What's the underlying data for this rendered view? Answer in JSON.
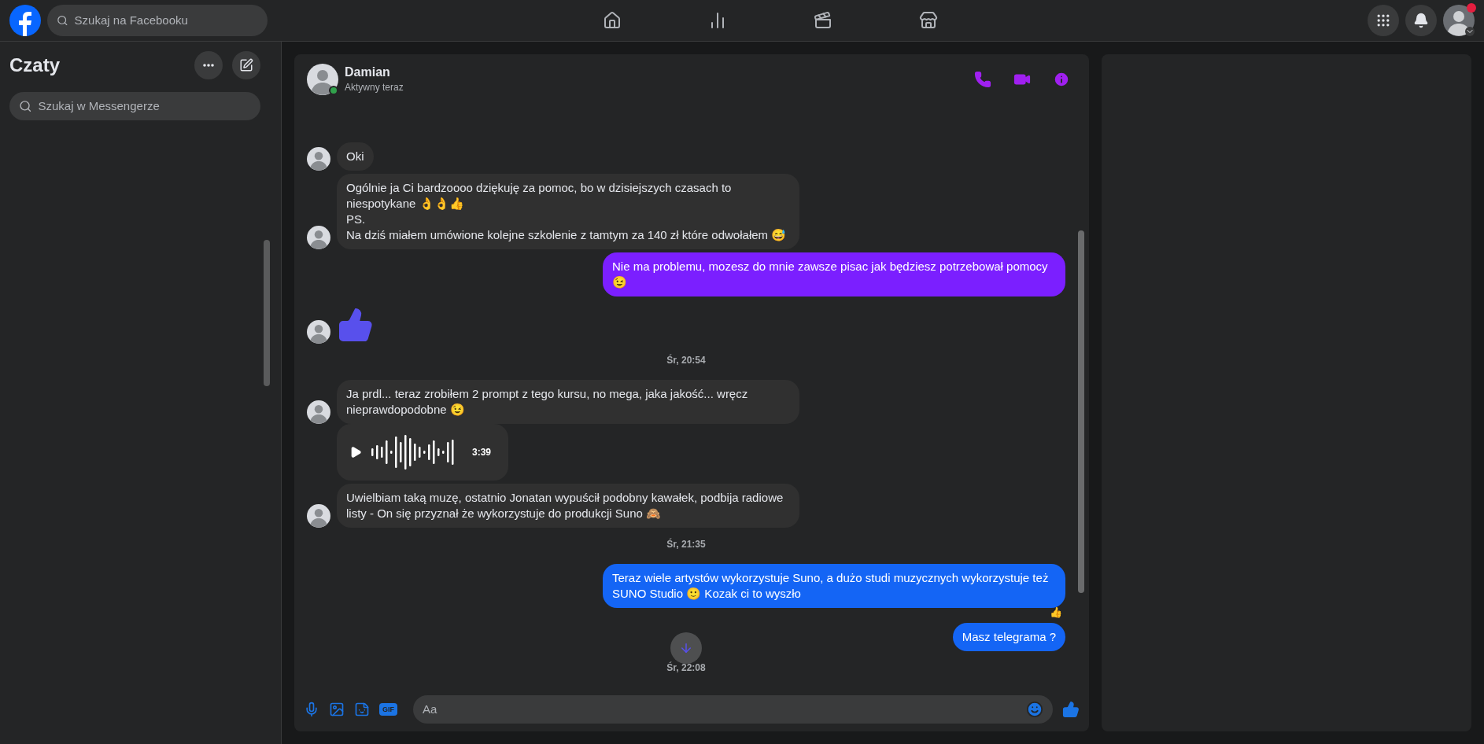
{
  "topbar": {
    "search_placeholder": "Szukaj na Facebooku",
    "notification_dot": true
  },
  "sidebar": {
    "title": "Czaty",
    "search_placeholder": "Szukaj w Messengerze"
  },
  "chat": {
    "name": "Damian",
    "status": "Aktywny teraz",
    "online": true,
    "messages": [
      {
        "kind": "text",
        "outgoing": false,
        "avatar": true,
        "text": "Oki"
      },
      {
        "kind": "text",
        "outgoing": false,
        "avatar": true,
        "text": "Ogólnie ja Ci bardzoooo dziękuję za pomoc, bo w dzisiejszych czasach to niespotykane 👌👌👍\nPS.\nNa dziś miałem umówione kolejne szkolenie z tamtym za 140 zł które odwołałem 😅"
      },
      {
        "kind": "text",
        "outgoing": true,
        "color": "#7b1fff",
        "text": "Nie ma problemu, mozesz do mnie zawsze pisac jak będziesz potrzebował pomocy 😉"
      },
      {
        "kind": "like",
        "avatar": true
      },
      {
        "kind": "time",
        "text": "Śr, 20:54"
      },
      {
        "kind": "text",
        "outgoing": false,
        "avatar": true,
        "text": "Ja prdl... teraz zrobiłem 2 prompt z tego kursu, no mega, jaka jakość... wręcz nieprawdopodobne 😉"
      },
      {
        "kind": "audio",
        "avatar": false,
        "duration": "3:39"
      },
      {
        "kind": "text",
        "outgoing": false,
        "avatar": true,
        "text": "Uwielbiam taką muzę, ostatnio Jonatan wypuścił podobny kawałek, podbija radiowe listy - On się przyznał że wykorzystuje do produkcji Suno 🙈"
      },
      {
        "kind": "time",
        "text": "Śr, 21:35"
      },
      {
        "kind": "text",
        "outgoing": true,
        "color": "#1465f5",
        "reaction": "👍",
        "text": "Teraz wiele artystów wykorzystuje Suno, a dużo studi muzycznych wykorzystuje też SUNO Studio 🙂 Kozak ci to wyszło"
      },
      {
        "kind": "text",
        "outgoing": true,
        "color": "#1465f5",
        "text": "Masz telegrama ?"
      },
      {
        "kind": "time",
        "text": "Śr, 22:08"
      }
    ],
    "composer": {
      "placeholder": "Aa",
      "gif_label": "GIF"
    }
  }
}
